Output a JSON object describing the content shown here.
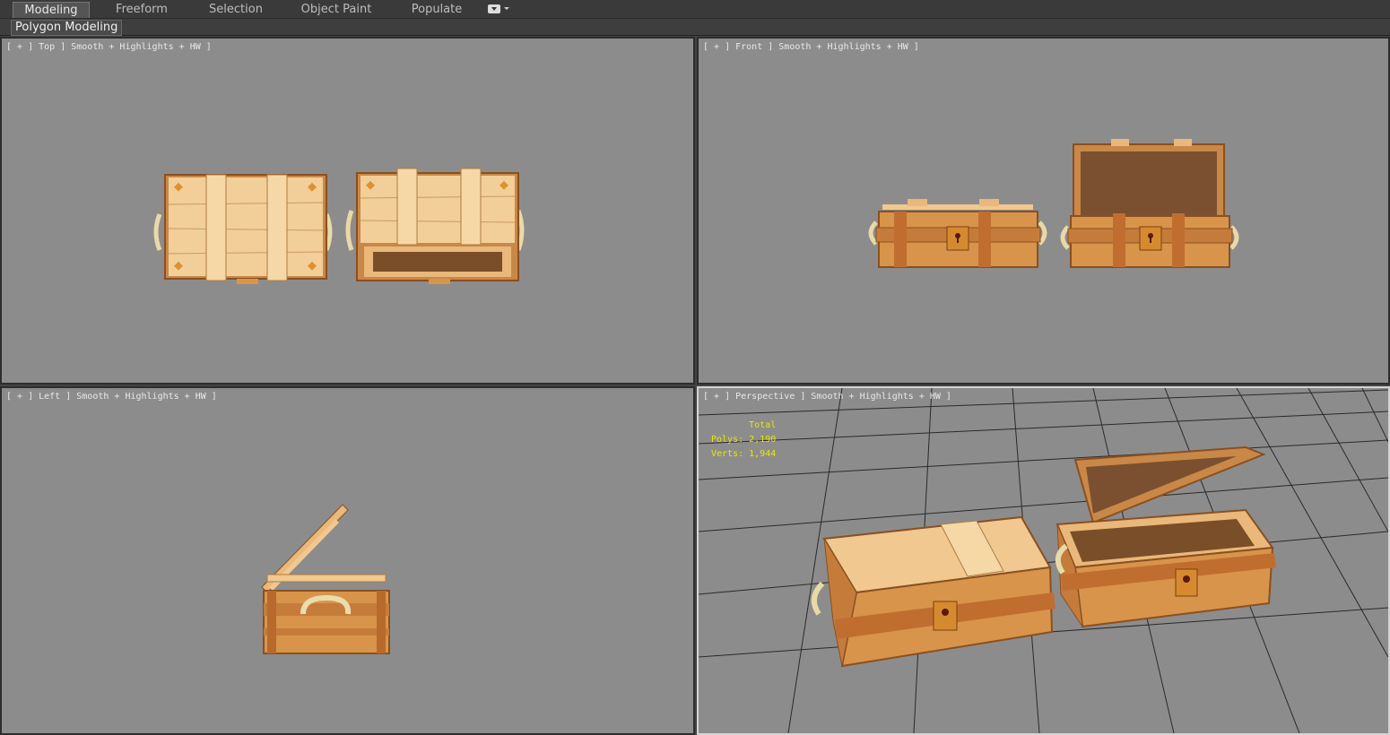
{
  "ribbon": {
    "tabs": [
      {
        "label": "Modeling",
        "active": true
      },
      {
        "label": "Freeform",
        "active": false
      },
      {
        "label": "Selection",
        "active": false
      },
      {
        "label": "Object Paint",
        "active": false
      },
      {
        "label": "Populate",
        "active": false
      }
    ],
    "panel_label": "Polygon Modeling"
  },
  "viewports": {
    "top": {
      "label": "[ + ] Top ] Smooth + Highlights + HW ]"
    },
    "front": {
      "label": "[ + ] Front ] Smooth + Highlights + HW ]"
    },
    "left": {
      "label": "[ + ] Left ] Smooth + Highlights + HW ]"
    },
    "perspective": {
      "label": "[ + ] Perspective ] Smooth + Highlights + HW ]",
      "stats": {
        "total": "Total",
        "polys": "Polys: 2,190",
        "verts": "Verts: 1,944"
      }
    }
  },
  "colors": {
    "viewport_bg": "#8c8c8c",
    "wood_light": "#f0c890",
    "wood_mid": "#d89050",
    "wood_dark": "#a85e28",
    "stats_text": "#e8e800",
    "active_border": "#d4d4d4"
  }
}
